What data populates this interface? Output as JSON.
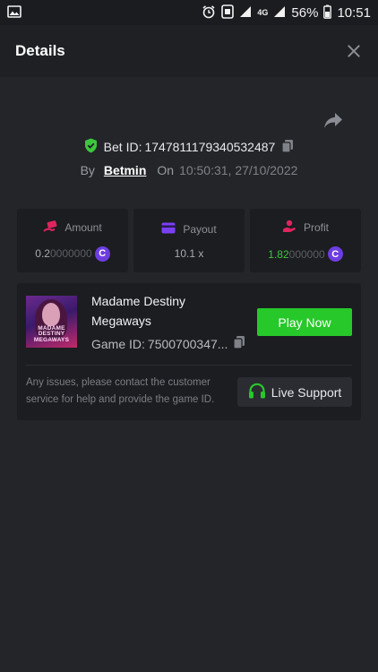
{
  "status_bar": {
    "network": "4G",
    "battery": "56%",
    "time": "10:51"
  },
  "header": {
    "title": "Details"
  },
  "bet": {
    "id_label": "Bet ID:",
    "id_value": "1747811179340532487",
    "by_label": "By",
    "user": "Betmin",
    "on_label": "On",
    "datetime": "10:50:31, 27/10/2022"
  },
  "stats": {
    "amount": {
      "label": "Amount",
      "value_main": "0.2",
      "value_dim": "0000000"
    },
    "payout": {
      "label": "Payout",
      "value": "10.1 x"
    },
    "profit": {
      "label": "Profit",
      "value_main": "1.82",
      "value_dim": "000000"
    }
  },
  "game": {
    "name": "Madame Destiny Megaways",
    "thumb_text": "MADAME DESTINY MEGAWAYS",
    "id_label": "Game ID:",
    "id_value": "7500700347...",
    "play_label": "Play Now"
  },
  "support": {
    "help_text": "Any issues, please contact the customer service for help and provide the game ID.",
    "button_label": "Live Support"
  },
  "colors": {
    "background": "#232529",
    "card": "#1b1d20",
    "accent_green": "#27c82a",
    "coin_purple": "#6d3de0",
    "shield_green": "#3ec73e"
  }
}
